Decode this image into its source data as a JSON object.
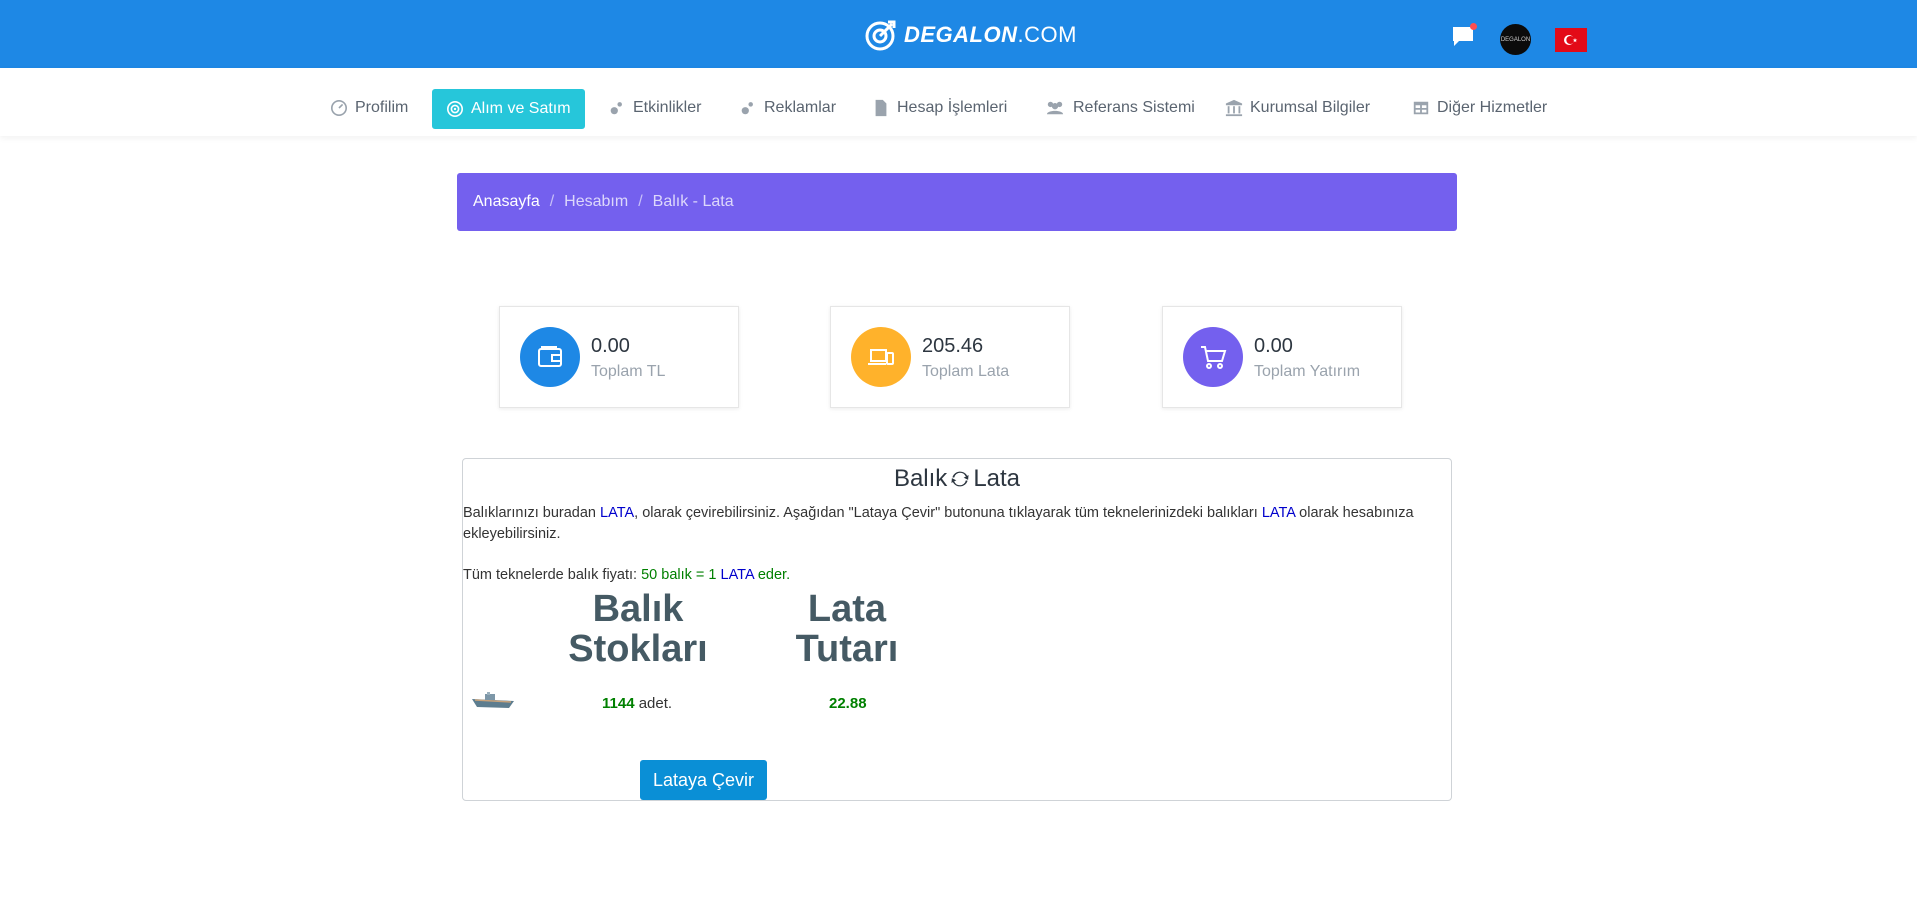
{
  "header": {
    "logo_text_bold": "DEGALON",
    "logo_text_suffix": ".COM",
    "avatar_text": "DEGALON",
    "icons": [
      "chat-icon",
      "avatar",
      "turkey-flag-icon"
    ],
    "brand_color": "#1e88e5"
  },
  "nav": {
    "items": [
      {
        "label": "Profilim",
        "icon": "dashboard-icon"
      },
      {
        "label": "Alım ve Satım",
        "icon": "target-icon",
        "active": true
      },
      {
        "label": "Etkinlikler",
        "icon": "bubbles-icon"
      },
      {
        "label": "Reklamlar",
        "icon": "bubbles-icon"
      },
      {
        "label": "Hesap İşlemleri",
        "icon": "document-icon"
      },
      {
        "label": "Referans Sistemi",
        "icon": "users-icon"
      },
      {
        "label": "Kurumsal Bilgiler",
        "icon": "bank-icon"
      },
      {
        "label": "Diğer Hizmetler",
        "icon": "table-icon"
      }
    ],
    "active_color": "#26c6da"
  },
  "breadcrumb": {
    "items": [
      "Anasayfa",
      "Hesabım",
      "Balık - Lata"
    ],
    "separator": "/",
    "color": "#7460ee"
  },
  "stats": [
    {
      "value": "0.00",
      "label": "Toplam TL",
      "icon": "wallet-icon",
      "color": "#1e88e5"
    },
    {
      "value": "205.46",
      "label": "Toplam Lata",
      "icon": "devices-icon",
      "color": "#ffb22b"
    },
    {
      "value": "0.00",
      "label": "Toplam Yatırım",
      "icon": "cart-icon",
      "color": "#7460ee"
    }
  ],
  "panel": {
    "title_left": "Balık",
    "title_right": "Lata",
    "title_icon": "refresh-icon",
    "text_1": "Balıklarınızı buradan ",
    "text_lata_1": "LATA",
    "text_2": ", olarak çevirebilirsiniz. Aşağıdan \"Lataya Çevir\" butonuna tıklayarak tüm teknelerinizdeki balıkları ",
    "text_lata_2": "LATA",
    "text_3": " olarak hesabınıza ekleyebilirsiniz.",
    "price_prefix": "Tüm teknelerde balık fiyatı: ",
    "price_green_1": "50 balık = 1 ",
    "price_lata": "LATA",
    "price_green_2": " eder.",
    "col1_heading": "Balık Stokları",
    "col2_heading": "Lata Tutarı",
    "fish_count": "1144",
    "fish_unit": " adet.",
    "lata_amount": "22.88",
    "button_label": "Lataya Çevir"
  }
}
